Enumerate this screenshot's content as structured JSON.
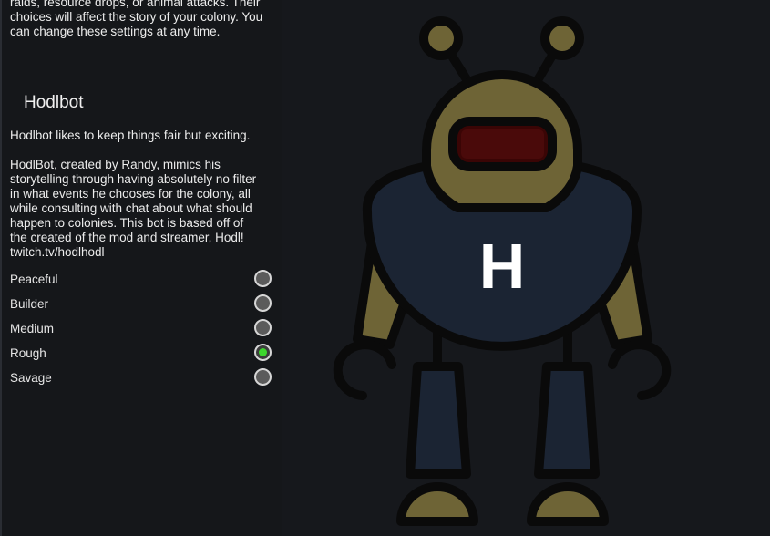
{
  "intro": {
    "text": "raids, resource drops, or animal attacks. Their\nchoices will affect the story of your colony. You\ncan change these settings at any time."
  },
  "storyteller": {
    "name": "Hodlbot",
    "tagline": "Hodlbot likes to keep things fair but exciting.",
    "description": "HodlBot, created by Randy, mimics his\nstorytelling through having absolutely no filter\nin what events he chooses for the colony, all\nwhile consulting with chat about what should\nhappen to colonies. This bot is based off of\nthe created of the mod and streamer, Hodl!\ntwitch.tv/hodlhodl",
    "portrait_letter": "H"
  },
  "difficulty": {
    "options": [
      {
        "label": "Peaceful",
        "selected": false
      },
      {
        "label": "Builder",
        "selected": false
      },
      {
        "label": "Medium",
        "selected": false
      },
      {
        "label": "Rough",
        "selected": true
      },
      {
        "label": "Savage",
        "selected": false
      }
    ]
  },
  "colors": {
    "background": "#16181c",
    "robot_gold": "#6e6436",
    "robot_body": "#1b2433",
    "robot_visor": "#3a0505",
    "radio_selected": "#3dd62d"
  }
}
